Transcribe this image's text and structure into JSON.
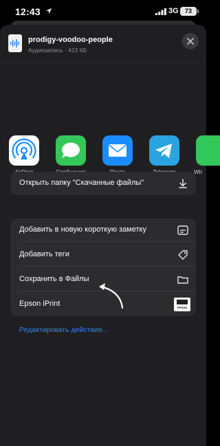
{
  "status_bar": {
    "time": "12:43",
    "network": "3G",
    "battery": "73"
  },
  "file": {
    "name": "prodigy-voodoo-people",
    "meta": "Аудиозапись · 413 КБ"
  },
  "apps": [
    {
      "label": "AirDrop",
      "icon": "airdrop-icon"
    },
    {
      "label": "Сообщения",
      "icon": "messages-icon"
    },
    {
      "label": "Почта",
      "icon": "mail-icon"
    },
    {
      "label": "Telegram",
      "icon": "telegram-icon"
    },
    {
      "label": "Wh",
      "icon": "whatsapp-icon"
    }
  ],
  "actions_top": {
    "open_folder": "Открыть папку \"Скачанные файлы\""
  },
  "actions": [
    {
      "label": "Добавить в новую короткую заметку",
      "icon": "quick-note-icon"
    },
    {
      "label": "Добавить теги",
      "icon": "tag-icon"
    },
    {
      "label": "Сохранить в Файлы",
      "icon": "folder-icon"
    },
    {
      "label": "Epson iPrint",
      "icon": "epson-icon",
      "icon_text": "EPSON"
    }
  ],
  "edit_actions": "Редактировать действия...",
  "colors": {
    "accent": "#2f86f5",
    "messages_green": "#34c759",
    "mail_blue": "#1a8cff",
    "telegram_blue": "#2aa3e0",
    "sheet_bg": "#1f1f21",
    "card_bg": "#2c2c2e"
  }
}
